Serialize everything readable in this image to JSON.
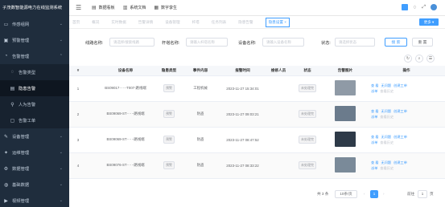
{
  "app": {
    "title": "子茂数智能源电力在线监测系统"
  },
  "sidebar": {
    "items": [
      {
        "label": "传感组网",
        "icon": "monitor-icon"
      },
      {
        "label": "预警管理",
        "icon": "warning-icon"
      },
      {
        "label": "告警管理",
        "icon": "alarm-icon"
      },
      {
        "label": "设备管理",
        "icon": "device-icon"
      },
      {
        "label": "运维管理",
        "icon": "tools-icon"
      },
      {
        "label": "数据管理",
        "icon": "gear-icon"
      },
      {
        "label": "基础数据",
        "icon": "globe-icon"
      },
      {
        "label": "视频管理",
        "icon": "video-icon"
      }
    ],
    "sub_items": [
      {
        "label": "告警类型"
      },
      {
        "label": "隐患告警"
      },
      {
        "label": "人为告警"
      },
      {
        "label": "告警工单"
      }
    ]
  },
  "header": {
    "links": [
      {
        "label": "数据看板",
        "icon": "dashboard-icon"
      },
      {
        "label": "系统文档",
        "icon": "document-icon"
      },
      {
        "label": "数字孪生",
        "icon": "twin-icon"
      }
    ],
    "accent": "#409eff"
  },
  "tabs": {
    "items": [
      "首页",
      "概况",
      "实时数据",
      "告警详情",
      "设备管理",
      "杆塔",
      "任务列表",
      "隐患告警",
      "隐患设置 ×"
    ],
    "right_button": "更多 ▾"
  },
  "filters": {
    "line_label": "线路名称:",
    "line_placeholder": "请选择/搜索线路",
    "tower_label": "杆塔名称:",
    "tower_placeholder": "请输入杆塔名称",
    "device_label": "设备名称:",
    "device_placeholder": "请输入设备名称",
    "status_label": "状态:",
    "status_placeholder": "请选择状态",
    "search_btn": "搜 索",
    "reset_btn": "重 置"
  },
  "toolbar": {
    "refresh_icon": "↻",
    "search_icon": "⌕",
    "columns_icon": "☰"
  },
  "table": {
    "headers": [
      "#",
      "",
      "设备名称",
      "隐患类型",
      "事件内容",
      "报警时间",
      "维修人员",
      "状态",
      "告警图片",
      "操作"
    ],
    "rows": [
      {
        "idx": "1",
        "device": "BS09017·····-T007-路线端",
        "type": "预警",
        "event": "工程机械",
        "time": "2023-11-27 15:34:01",
        "repair": "",
        "status": "未处理完",
        "thumb": "#8f9aa6"
      },
      {
        "idx": "2",
        "device": "BS09069-ST·····-路线端",
        "type": "预警",
        "event": "防盗",
        "time": "2023-11-27 09:03:21",
        "repair": "",
        "status": "未处理完",
        "thumb": "#6b7b8c"
      },
      {
        "idx": "3",
        "device": "BS09069-ST·····-路线端",
        "type": "预警",
        "event": "防盗",
        "time": "2023-11-27 08:47:52",
        "repair": "",
        "status": "未处理完",
        "thumb": "#2e3a48"
      },
      {
        "idx": "4",
        "device": "BS09076-ST·····-路线端",
        "type": "预警",
        "event": "防盗",
        "time": "2023-11-27 08:33:22",
        "repair": "",
        "status": "未处理完",
        "thumb": "#7a8a99"
      }
    ],
    "actions": {
      "view": "查 看",
      "no_problem": "无问题",
      "create": "创建工单",
      "assign": "派单",
      "history": "查看历史"
    }
  },
  "pagination": {
    "total": "共 3 条",
    "page_size": "10条/页",
    "current": "1",
    "goto_label": "前往",
    "goto_value": "1",
    "page_suffix": "页"
  }
}
